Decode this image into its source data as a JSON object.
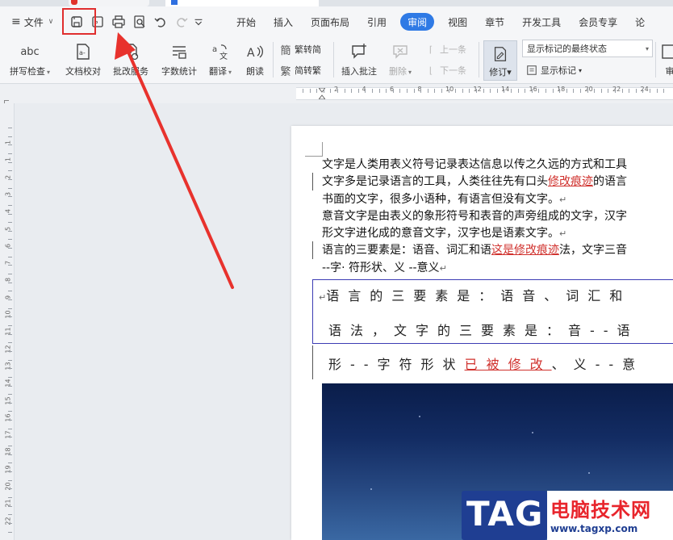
{
  "menu": {
    "file_label": "文件",
    "tabs": [
      "开始",
      "插入",
      "页面布局",
      "引用",
      "审阅",
      "视图",
      "章节",
      "开发工具",
      "会员专享",
      "论"
    ],
    "active_tab": "审阅"
  },
  "quick_access": {
    "icons": [
      "save-icon",
      "export-pdf-icon",
      "print-icon",
      "print-preview-icon",
      "undo-icon",
      "redo-icon",
      "customize-icon"
    ]
  },
  "toolbar": {
    "spell_check": "拼写检查",
    "spell_check_icon_text": "abc",
    "doc_proofread": "文档校对",
    "batch_service": "批改服务",
    "word_count": "字数统计",
    "translate": "翻译",
    "read_aloud": "朗读",
    "trad_to_simp": "繁转简",
    "simp_to_trad": "简转繁",
    "insert_comment": "插入批注",
    "delete": "删除",
    "prev": "上一条",
    "next": "下一条",
    "revise": "修订",
    "markup_select": "显示标记的最终状态",
    "show_markup": "显示标记",
    "review_partial": "审"
  },
  "ruler": {
    "h_numbers": [
      "2",
      "4",
      "6",
      "8",
      "10",
      "12",
      "14",
      "16",
      "18",
      "20",
      "22",
      "24"
    ],
    "v_numbers": [
      "1",
      "1",
      "2",
      "3",
      "4",
      "5",
      "6",
      "7",
      "8",
      "9",
      "10",
      "11",
      "12",
      "13",
      "14",
      "15",
      "16",
      "17",
      "18",
      "19",
      "20",
      "21",
      "22"
    ]
  },
  "document": {
    "line1": "文字是人类用表义符号记录表达信息以传之久远的方式和工具",
    "line2_a": "文字多是记录语言的工具，人类往往先有口头",
    "line2_rev": "修改痕迹",
    "line2_b": "的语言",
    "line3": "书面的文字，很多小语种，有语言但没有文字。",
    "line4": "意音文字是由表义的象形符号和表音的声旁组成的文字，汉字",
    "line5": "形文字进化成的意音文字，汉字也是语素文字。",
    "line6_a": "语言的三要素是：语音、词汇和语",
    "line6_rev": "这是修改痕迹",
    "line6_b": "法，文字三音",
    "line7": " --字· 符形状、义 --意义",
    "table_line1": "语言的三要素是：语音、词汇和",
    "table_line2": "语法，文字的三要素是：音--语",
    "table_line3_a": "形--字符形状",
    "table_line3_rev": "已被修改",
    "table_line3_b": "、义--意"
  },
  "watermark": {
    "tag": "TAG",
    "cn": "电脑技术网",
    "url": "www.tagxp.com"
  }
}
